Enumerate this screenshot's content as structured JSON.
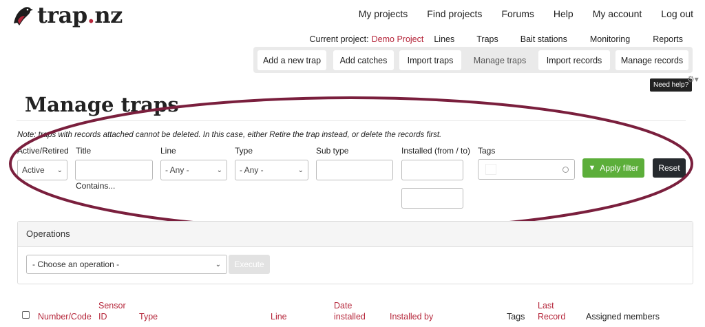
{
  "brand": {
    "name_part1": "trap",
    "name_dot": ".",
    "name_part2": "nz"
  },
  "topnav": [
    "My projects",
    "Find projects",
    "Forums",
    "Help",
    "My account",
    "Log out"
  ],
  "project_nav": {
    "current_label": "Current project:",
    "current_project": "Demo Project",
    "links": [
      "Lines",
      "Traps",
      "Bait stations",
      "Monitoring",
      "Reports"
    ]
  },
  "tabs": [
    "Add a new trap",
    "Add catches",
    "Import traps",
    "Manage traps",
    "Import records",
    "Manage records"
  ],
  "active_tab": "Manage traps",
  "help_badge": "Need help?",
  "page_title": "Manage traps",
  "note": "Note: traps with records attached cannot be deleted. In this case, either Retire the trap instead, or delete the records first.",
  "filters": {
    "active_label": "Active/Retired",
    "active_value": "Active",
    "title_label": "Title",
    "title_value": "",
    "title_hint": "Contains...",
    "line_label": "Line",
    "line_value": "- Any -",
    "type_label": "Type",
    "type_value": "- Any -",
    "subtype_label": "Sub type",
    "subtype_value": "",
    "installed_label": "Installed (from / to)",
    "installed_from": "",
    "installed_to": "",
    "tags_label": "Tags",
    "tags_value": "",
    "apply_label": "Apply filter",
    "reset_label": "Reset"
  },
  "operations": {
    "header": "Operations",
    "select_value": "- Choose an operation -",
    "execute_label": "Execute"
  },
  "table_headers": {
    "number_code": "Number/Code",
    "sensor_id_1": "Sensor",
    "sensor_id_2": "ID",
    "type": "Type",
    "line": "Line",
    "date_installed_1": "Date",
    "date_installed_2": "installed",
    "installed_by": "Installed by",
    "tags": "Tags",
    "last_record_1": "Last",
    "last_record_2": "Record",
    "assigned_members": "Assigned members"
  },
  "colors": {
    "brand_red": "#b5263a",
    "apply_green": "#5cae3a",
    "annotation_ellipse": "#7a1f3d"
  }
}
